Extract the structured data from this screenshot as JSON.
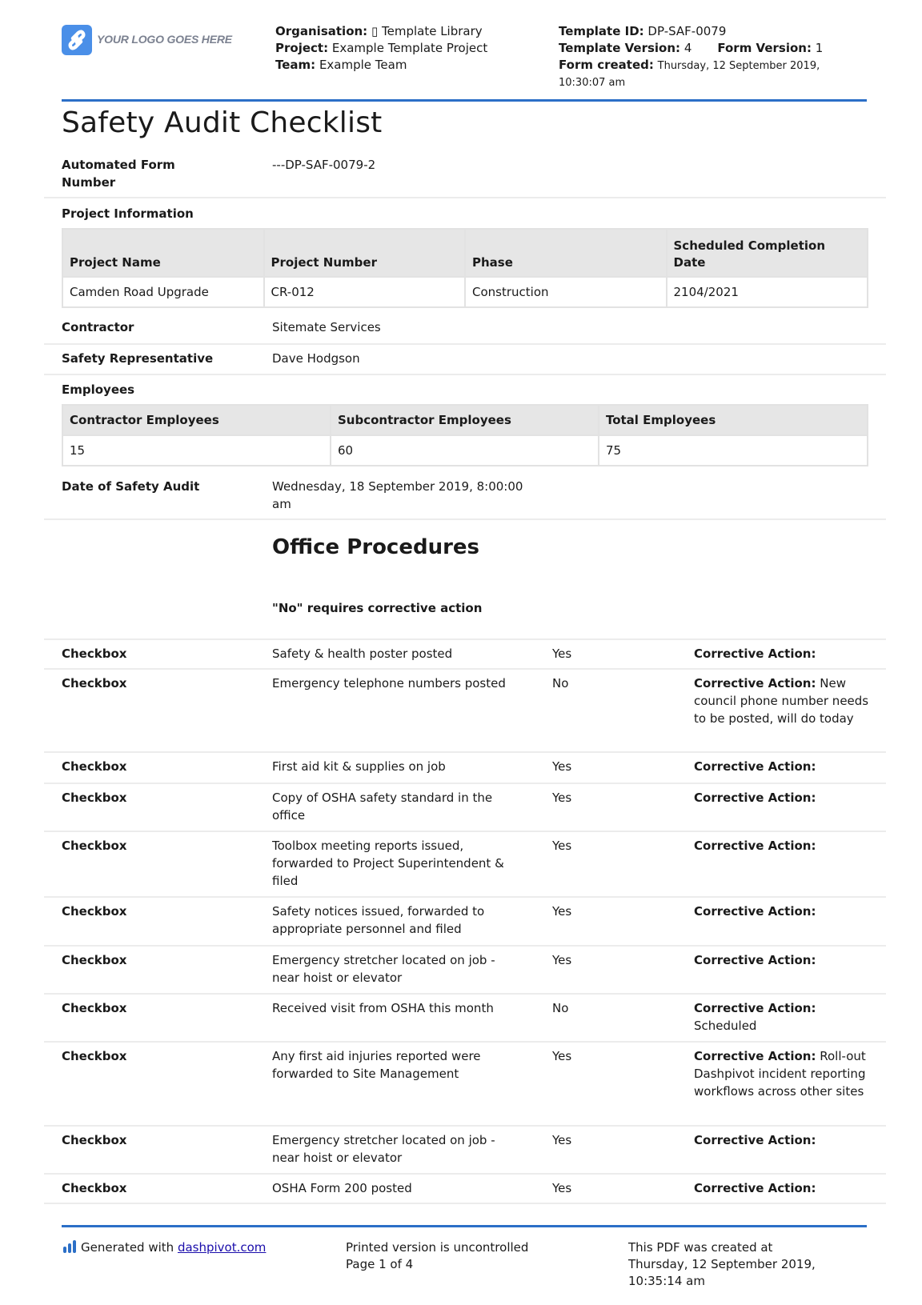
{
  "header": {
    "logo_text": "YOUR LOGO GOES HERE",
    "organisation_label": "Organisation:",
    "organisation_value": "▯ Template Library",
    "project_label": "Project:",
    "project_value": "Example Template Project",
    "team_label": "Team:",
    "team_value": "Example Team",
    "template_id_label": "Template ID:",
    "template_id_value": "DP-SAF-0079",
    "template_version_label": "Template Version:",
    "template_version_value": "4",
    "form_version_label": "Form Version:",
    "form_version_value": "1",
    "form_created_label": "Form created:",
    "form_created_date": "Thursday, 12 September 2019,",
    "form_created_time": "10:30:07 am"
  },
  "title": "Safety Audit Checklist",
  "automated_form_number": {
    "label_line1": "Automated Form",
    "label_line2": "Number",
    "value": "---DP-SAF-0079-2"
  },
  "project_information": {
    "label": "Project Information",
    "headers": [
      "Project Name",
      "Project Number",
      "Phase",
      "Scheduled Completion Date"
    ],
    "row": [
      "Camden Road Upgrade",
      "CR-012",
      "Construction",
      "2104/2021"
    ]
  },
  "contractor": {
    "label": "Contractor",
    "value": "Sitemate Services"
  },
  "safety_representative": {
    "label": "Safety Representative",
    "value": "Dave Hodgson"
  },
  "employees": {
    "label": "Employees",
    "headers": [
      "Contractor Employees",
      "Subcontractor Employees",
      "Total Employees"
    ],
    "row": [
      "15",
      "60",
      "75"
    ]
  },
  "date_of_audit": {
    "label": "Date of Safety Audit",
    "value_line1": "Wednesday, 18 September 2019, 8:00:00",
    "value_line2": "am"
  },
  "section": {
    "title": "Office Procedures",
    "note": "\"No\" requires corrective action",
    "corrective_label": "Corrective Action:",
    "items": [
      {
        "type": "Checkbox",
        "item": "Safety & health poster posted",
        "answer": "Yes",
        "action": ""
      },
      {
        "type": "Checkbox",
        "item": "Emergency telephone numbers posted",
        "answer": "No",
        "action": "New council phone number needs to be posted, will do today"
      },
      {
        "type": "Checkbox",
        "item": "First aid kit & supplies on job",
        "answer": "Yes",
        "action": ""
      },
      {
        "type": "Checkbox",
        "item": "Copy of OSHA safety standard in the office",
        "answer": "Yes",
        "action": ""
      },
      {
        "type": "Checkbox",
        "item": "Toolbox meeting reports issued, forwarded to Project Superintendent & filed",
        "answer": "Yes",
        "action": ""
      },
      {
        "type": "Checkbox",
        "item": "Safety notices issued, forwarded to appropriate personnel and filed",
        "answer": "Yes",
        "action": ""
      },
      {
        "type": "Checkbox",
        "item": "Emergency stretcher located on job - near hoist or elevator",
        "answer": "Yes",
        "action": ""
      },
      {
        "type": "Checkbox",
        "item": "Received visit from OSHA this month",
        "answer": "No",
        "action": "Scheduled"
      },
      {
        "type": "Checkbox",
        "item": "Any first aid injuries reported were forwarded to Site Management",
        "answer": "Yes",
        "action": "Roll-out Dashpivot incident reporting workflows across other sites"
      },
      {
        "type": "Checkbox",
        "item": "Emergency stretcher located on job - near hoist or elevator",
        "answer": "Yes",
        "action": ""
      },
      {
        "type": "Checkbox",
        "item": "OSHA Form 200 posted",
        "answer": "Yes",
        "action": ""
      }
    ]
  },
  "footer": {
    "generated_prefix": "Generated with",
    "generated_link": "dashpivot.com",
    "uncontrolled": "Printed version is uncontrolled",
    "page": "Page 1 of 4",
    "created_line1": "This PDF was created at",
    "created_line2": "Thursday, 12 September 2019,",
    "created_line3": "10:35:14 am"
  },
  "colors": {
    "accent": "#2b6fc7",
    "logo": "#4a8fe8",
    "table_header_bg": "#e6e6e6",
    "divider": "#ececec",
    "link": "#1a0dab"
  }
}
